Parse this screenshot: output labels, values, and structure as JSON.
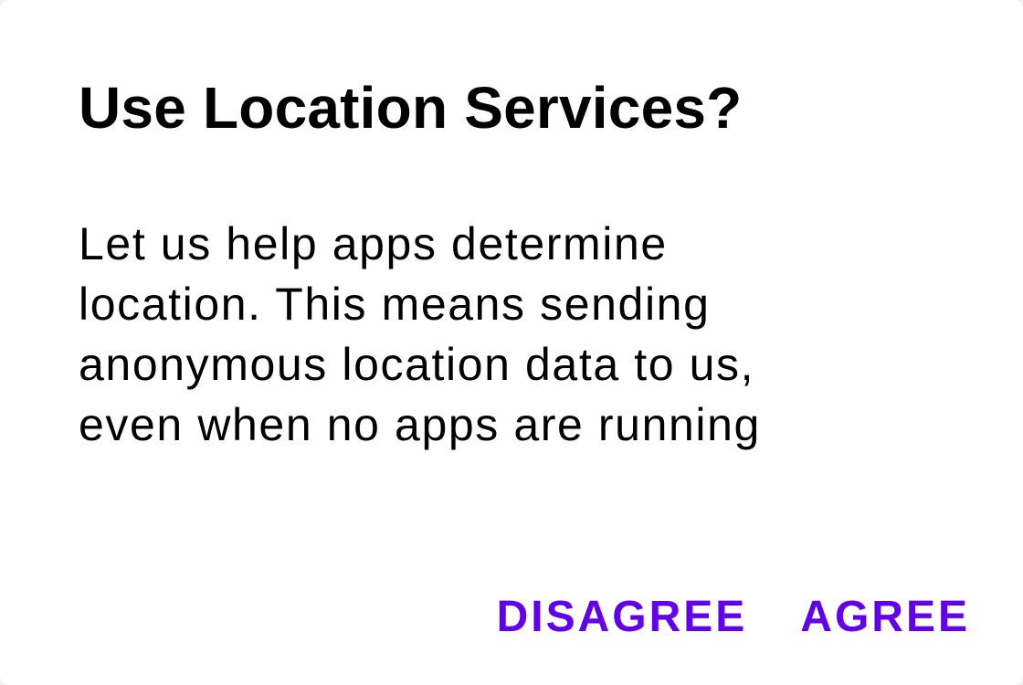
{
  "dialog": {
    "title": "Use Location Services?",
    "body_lines": [
      "Let us help apps determine",
      "location. This means sending",
      "anonymous location data to us,",
      "even when no apps are running"
    ],
    "actions": {
      "disagree_label": "DISAGREE",
      "agree_label": "AGREE"
    }
  },
  "colors": {
    "accent": "#6200ee",
    "text": "#000000",
    "surface": "#ffffff"
  }
}
